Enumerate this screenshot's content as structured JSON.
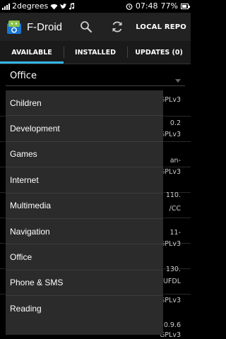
{
  "status_bar": {
    "carrier": "2degrees",
    "time": "07:48",
    "battery": "77%"
  },
  "action_bar": {
    "title": "F-Droid",
    "search_icon": "search-icon",
    "refresh_icon": "refresh-icon",
    "local_repo_label": "LOCAL REPO"
  },
  "tabs": [
    {
      "label": "AVAILABLE",
      "active": true
    },
    {
      "label": "INSTALLED",
      "active": false
    },
    {
      "label": "UPDATES (0)",
      "active": false
    }
  ],
  "category_selector": {
    "selected": "Office"
  },
  "dropdown": {
    "items": [
      "Children",
      "Development",
      "Games",
      "Internet",
      "Multimedia",
      "Navigation",
      "Office",
      "Phone & SMS",
      "Reading"
    ]
  },
  "background_list": {
    "fragments": [
      "GPLv3",
      "0.2",
      "GPLv3",
      "an-",
      "GPLv3",
      "110.",
      "/CC",
      "11-",
      "GPLv3",
      "130.",
      "NUFDL",
      "GPLv3",
      "0.9.6",
      "GPLv3"
    ]
  },
  "colors": {
    "accent": "#33b5e5",
    "action_bar": "#222222",
    "dropdown_bg": "#2b2b2b"
  }
}
